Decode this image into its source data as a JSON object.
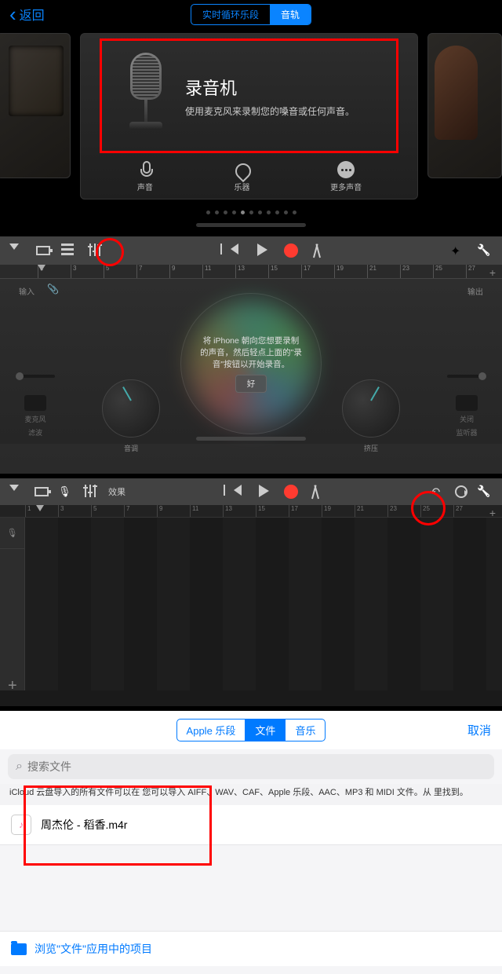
{
  "sec1": {
    "back": "返回",
    "tabs": [
      "实时循环乐段",
      "音轨"
    ],
    "active_tab": 1,
    "recorder": {
      "title": "录音机",
      "desc": "使用麦克风来录制您的嗓音或任何声音。"
    },
    "subitems": [
      {
        "label": "声音"
      },
      {
        "label": "乐器"
      },
      {
        "label": "更多声音"
      }
    ],
    "dot_count": 11,
    "active_dot": 4
  },
  "sec2": {
    "ruler": [
      "1",
      "3",
      "5",
      "7",
      "9",
      "11",
      "13",
      "15",
      "17",
      "19",
      "21",
      "23",
      "25",
      "27"
    ],
    "input_label": "输入",
    "output_label": "输出",
    "hint": "将 iPhone 朝向您想要录制的声音，然后轻点上面的\"录音\"按钮以开始录音。",
    "ok": "好",
    "dial1": "音调",
    "dial2": "挤压",
    "panel_left_top": "麦克风",
    "panel_left_bottom": "滤波",
    "panel_right_top": "关闭",
    "panel_right_bottom": "监听器"
  },
  "sec3": {
    "fx": "效果",
    "ruler": [
      "1",
      "3",
      "5",
      "7",
      "9",
      "11",
      "13",
      "15",
      "17",
      "19",
      "21",
      "23",
      "25",
      "27"
    ]
  },
  "sec4": {
    "tabs": [
      "Apple 乐段",
      "文件",
      "音乐"
    ],
    "active_tab": 1,
    "cancel": "取消",
    "search_placeholder": "搜索文件",
    "hint_prefix": "iCloud 云盘导入的所有文件可以在",
    "hint_main": "您可以导入 AIFF、WAV、CAF、Apple 乐段、AAC、MP3 和 MIDI 文件。从",
    "hint_suffix": "里找到。",
    "file": "周杰伦 - 稻香.m4r",
    "browse": "浏览\"文件\"应用中的项目"
  }
}
